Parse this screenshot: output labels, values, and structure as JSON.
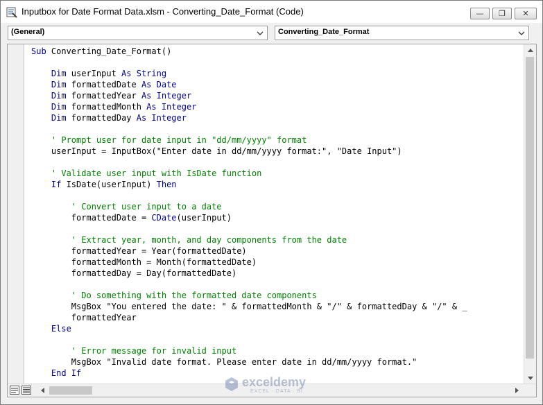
{
  "window": {
    "title": "Inputbox for Date Format Data.xlsm - Converting_Date_Format (Code)",
    "minimize_glyph": "—",
    "maximize_glyph": "❐",
    "close_glyph": "✕"
  },
  "selectors": {
    "object": "(General)",
    "procedure": "Converting_Date_Format"
  },
  "code_lines": [
    [
      {
        "t": "Sub ",
        "c": "kw"
      },
      {
        "t": "Converting_Date_Format()",
        "c": ""
      }
    ],
    [],
    [
      {
        "t": "    Dim ",
        "c": "kw"
      },
      {
        "t": "userInput ",
        "c": ""
      },
      {
        "t": "As String",
        "c": "kw"
      }
    ],
    [
      {
        "t": "    Dim ",
        "c": "kw"
      },
      {
        "t": "formattedDate ",
        "c": ""
      },
      {
        "t": "As Date",
        "c": "kw"
      }
    ],
    [
      {
        "t": "    Dim ",
        "c": "kw"
      },
      {
        "t": "formattedYear ",
        "c": ""
      },
      {
        "t": "As Integer",
        "c": "kw"
      }
    ],
    [
      {
        "t": "    Dim ",
        "c": "kw"
      },
      {
        "t": "formattedMonth ",
        "c": ""
      },
      {
        "t": "As Integer",
        "c": "kw"
      }
    ],
    [
      {
        "t": "    Dim ",
        "c": "kw"
      },
      {
        "t": "formattedDay ",
        "c": ""
      },
      {
        "t": "As Integer",
        "c": "kw"
      }
    ],
    [],
    [
      {
        "t": "    ' Prompt user for date input in \"dd/mm/yyyy\" format",
        "c": "cm"
      }
    ],
    [
      {
        "t": "    userInput = InputBox(\"Enter date in dd/mm/yyyy format:\", \"Date Input\")",
        "c": ""
      }
    ],
    [],
    [
      {
        "t": "    ' Validate user input with IsDate function",
        "c": "cm"
      }
    ],
    [
      {
        "t": "    If ",
        "c": "kw"
      },
      {
        "t": "IsDate(userInput) ",
        "c": ""
      },
      {
        "t": "Then",
        "c": "kw"
      }
    ],
    [],
    [
      {
        "t": "        ' Convert user input to a date",
        "c": "cm"
      }
    ],
    [
      {
        "t": "        formattedDate = ",
        "c": ""
      },
      {
        "t": "CDate",
        "c": "kw"
      },
      {
        "t": "(userInput)",
        "c": ""
      }
    ],
    [],
    [
      {
        "t": "        ' Extract year, month, and day components from the date",
        "c": "cm"
      }
    ],
    [
      {
        "t": "        formattedYear = Year(formattedDate)",
        "c": ""
      }
    ],
    [
      {
        "t": "        formattedMonth = Month(formattedDate)",
        "c": ""
      }
    ],
    [
      {
        "t": "        formattedDay = Day(formattedDate)",
        "c": ""
      }
    ],
    [],
    [
      {
        "t": "        ' Do something with the formatted date components",
        "c": "cm"
      }
    ],
    [
      {
        "t": "        MsgBox \"You entered the date: \" & formattedMonth & \"/\" & formattedDay & \"/\" & _",
        "c": ""
      }
    ],
    [
      {
        "t": "        formattedYear",
        "c": ""
      }
    ],
    [
      {
        "t": "    Else",
        "c": "kw"
      }
    ],
    [],
    [
      {
        "t": "        ' Error message for invalid input",
        "c": "cm"
      }
    ],
    [
      {
        "t": "        MsgBox \"Invalid date format. Please enter date in dd/mm/yyyy format.\"",
        "c": ""
      }
    ],
    [
      {
        "t": "    End If",
        "c": "kw"
      }
    ]
  ],
  "watermark": {
    "name": "exceldemy",
    "tagline": "EXCEL · DATA · BI"
  },
  "colors": {
    "keyword": "#00008b",
    "comment": "#008000"
  }
}
